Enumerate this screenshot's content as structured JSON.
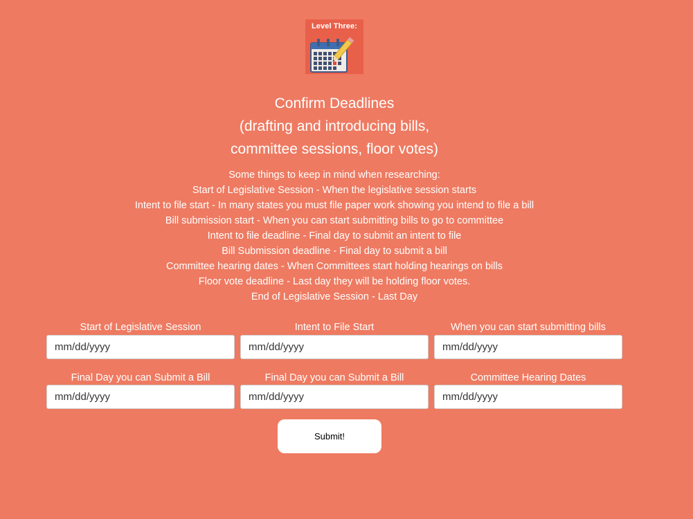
{
  "badge": {
    "title": "Level Three:",
    "icon": "calendar-pencil-icon"
  },
  "heading": {
    "lines": [
      "Confirm Deadlines",
      "(drafting and introducing bills,",
      "committee sessions, floor votes)"
    ]
  },
  "notes": {
    "lines": [
      "Some things to keep in mind when researching:",
      "Start of Legislative Session - When the legislative session starts",
      "Intent to file start - In many states you must file paper work showing you intend to file a bill",
      "Bill submission start - When you can start submitting bills to go to committee",
      "Intent to file deadline - Final day to submit an intent to file",
      "Bill Submission deadline - Final day to submit a bill",
      "Committee hearing dates - When Committees start holding hearings on bills",
      "Floor vote deadline - Last day they will be holding floor votes.",
      "End of Legislative Session - Last Day"
    ]
  },
  "form": {
    "fields": [
      {
        "label": "Start of Legislative Session",
        "placeholder": "mm/dd/yyyy",
        "value": ""
      },
      {
        "label": "Intent to File Start",
        "placeholder": "mm/dd/yyyy",
        "value": ""
      },
      {
        "label": "When you can start submitting bills",
        "placeholder": "mm/dd/yyyy",
        "value": ""
      },
      {
        "label": "Final Day you can Submit a Bill",
        "placeholder": "mm/dd/yyyy",
        "value": ""
      },
      {
        "label": "Final Day you can Submit a Bill",
        "placeholder": "mm/dd/yyyy",
        "value": ""
      },
      {
        "label": "Committee Hearing Dates",
        "placeholder": "mm/dd/yyyy",
        "value": ""
      }
    ],
    "submit_label": "Submit!"
  },
  "colors": {
    "background": "#ee7a61",
    "badge_background": "#e8604a",
    "text": "#ffffff",
    "input_background": "#ffffff"
  }
}
